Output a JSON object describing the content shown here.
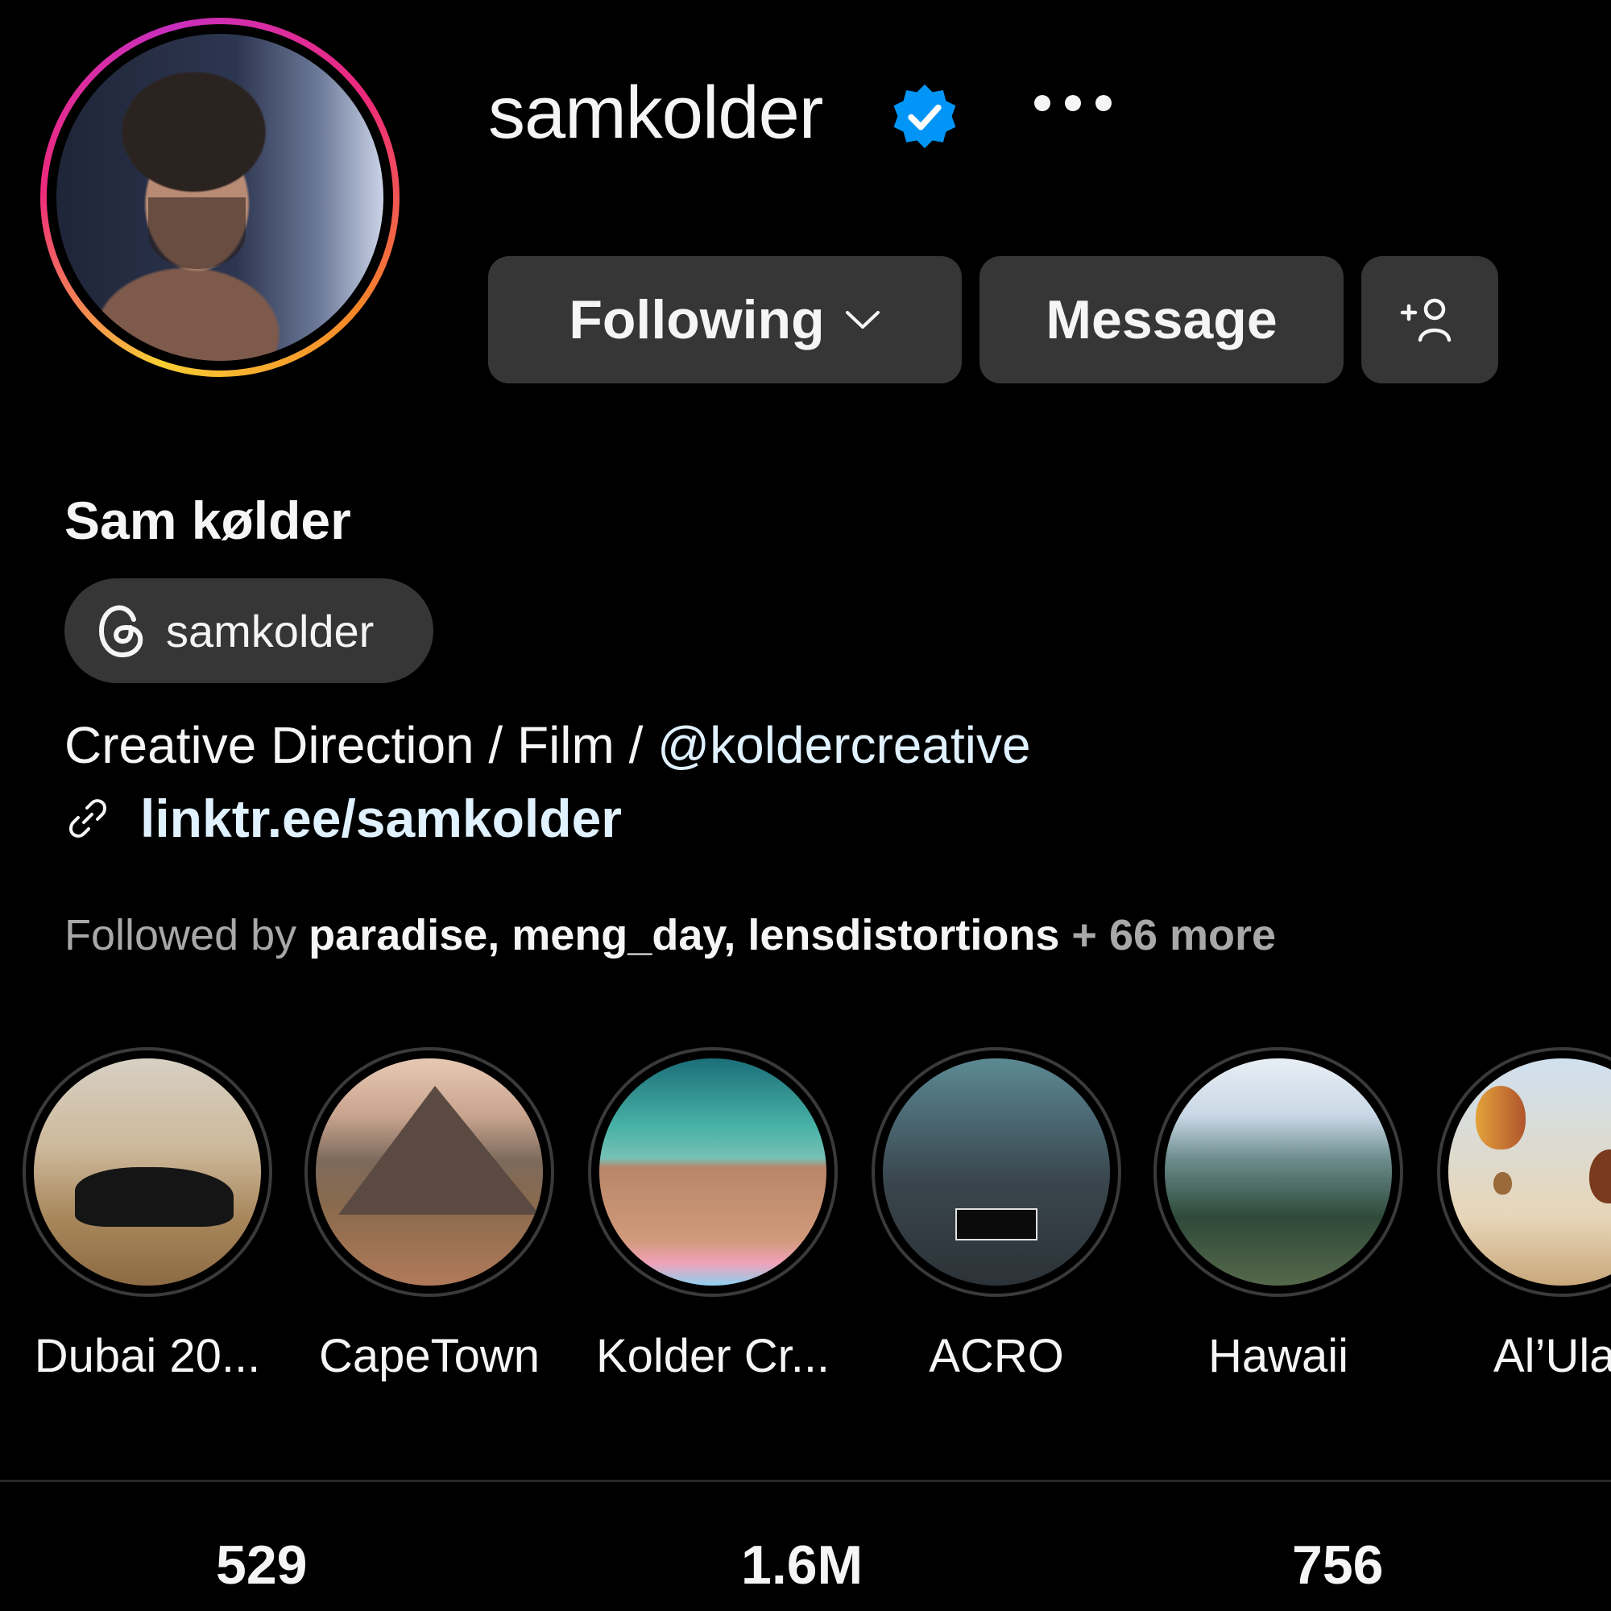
{
  "profile": {
    "username": "samkolder",
    "full_name": "Sam kølder",
    "threads_handle": "samkolder",
    "bio_prefix": "Creative Direction / Film / ",
    "bio_mention": "@koldercreative",
    "link": "linktr.ee/samkolder",
    "verified": true
  },
  "actions": {
    "following_label": "Following",
    "message_label": "Message"
  },
  "followed_by": {
    "prefix": "Followed by ",
    "names": "paradise, meng_day, lensdistortions",
    "more": " + 66 more"
  },
  "highlights": [
    {
      "label": "Dubai 20..."
    },
    {
      "label": "CapeTown"
    },
    {
      "label": "Kolder Cr..."
    },
    {
      "label": "ACRO"
    },
    {
      "label": "Hawaii"
    },
    {
      "label": "Al’Ula"
    }
  ],
  "stats": {
    "posts": "529",
    "followers": "1.6M",
    "following": "756"
  },
  "colors": {
    "background": "#000000",
    "button": "#363636",
    "link": "#e0f1ff",
    "verified": "#0095f6"
  }
}
